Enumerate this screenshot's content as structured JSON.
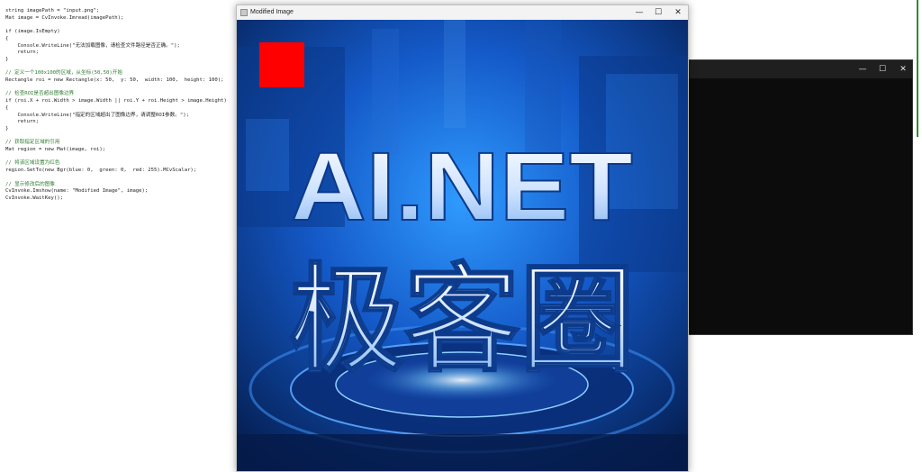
{
  "editor": {
    "lines": [
      {
        "kind": "code",
        "text": "string imagePath = \"input.png\";"
      },
      {
        "kind": "code",
        "text": "Mat image = CvInvoke.Imread(imagePath);"
      },
      {
        "kind": "blank",
        "text": ""
      },
      {
        "kind": "code",
        "text": "if (image.IsEmpty)"
      },
      {
        "kind": "code",
        "text": "{"
      },
      {
        "kind": "code",
        "text": "    Console.WriteLine(\"无法加载图像，请检查文件路径是否正确。\");"
      },
      {
        "kind": "code",
        "text": "    return;"
      },
      {
        "kind": "code",
        "text": "}"
      },
      {
        "kind": "blank",
        "text": ""
      },
      {
        "kind": "comment",
        "text": "// 定义一个100x100的区域，从坐标(50,50)开始"
      },
      {
        "kind": "code",
        "text": "Rectangle roi = new Rectangle(x: 50,  y: 50,  width: 100,  height: 100);"
      },
      {
        "kind": "blank",
        "text": ""
      },
      {
        "kind": "comment",
        "text": "// 检查ROI是否超出图像边界"
      },
      {
        "kind": "code",
        "text": "if (roi.X + roi.Width > image.Width || roi.Y + roi.Height > image.Height)"
      },
      {
        "kind": "code",
        "text": "{"
      },
      {
        "kind": "code",
        "text": "    Console.WriteLine(\"指定的区域超出了图像边界，请调整ROI参数。\");"
      },
      {
        "kind": "code",
        "text": "    return;"
      },
      {
        "kind": "code",
        "text": "}"
      },
      {
        "kind": "blank",
        "text": ""
      },
      {
        "kind": "comment",
        "text": "// 获取指定区域的引用"
      },
      {
        "kind": "code",
        "text": "Mat region = new Mat(image, roi);"
      },
      {
        "kind": "blank",
        "text": ""
      },
      {
        "kind": "comment",
        "text": "// 将该区域设置为红色"
      },
      {
        "kind": "code",
        "text": "region.SetTo(new Bgr(blue: 0,  green: 0,  red: 255).MCvScalar);"
      },
      {
        "kind": "blank",
        "text": ""
      },
      {
        "kind": "comment",
        "text": "// 显示修改后的图像"
      },
      {
        "kind": "code",
        "text": "CvInvoke.Imshow(name: \"Modified Image\", image);"
      },
      {
        "kind": "code",
        "text": "CvInvoke.WaitKey();"
      }
    ]
  },
  "console_window": {
    "minimize": "—",
    "maximize": "☐",
    "close": "✕"
  },
  "image_window": {
    "title": "Modified Image",
    "minimize": "—",
    "maximize": "☐",
    "close": "✕",
    "image_text_line1": "AI.NET",
    "image_text_line2": "极客圈",
    "roi_color": "#ff0000"
  },
  "colors": {
    "image_bg_dark": "#062a6e",
    "image_bg_light": "#1f7fe0",
    "text_fill": "#dfeeff"
  }
}
